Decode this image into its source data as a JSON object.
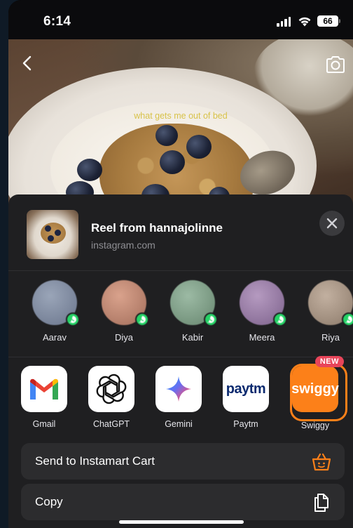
{
  "status_bar": {
    "time": "6:14",
    "battery": "66"
  },
  "reel": {
    "caption": "what gets me out of bed"
  },
  "share": {
    "title": "Reel from hannajolinne",
    "subtitle": "instagram.com"
  },
  "contacts": [
    {
      "name": "Aarav",
      "color": "#7f8aa0"
    },
    {
      "name": "Diya",
      "color": "#c08a76"
    },
    {
      "name": "Kabir",
      "color": "#7fa08a"
    },
    {
      "name": "Meera",
      "color": "#9a7fa6"
    },
    {
      "name": "Riya",
      "color": "#a89686"
    }
  ],
  "apps": [
    {
      "name": "Gmail",
      "icon": "gmail-icon"
    },
    {
      "name": "ChatGPT",
      "icon": "chatgpt-icon"
    },
    {
      "name": "Gemini",
      "icon": "gemini-icon"
    },
    {
      "name": "Paytm",
      "icon": "paytm-icon",
      "logo": "paytm"
    },
    {
      "name": "Swiggy",
      "icon": "swiggy-icon",
      "logo": "swiggy",
      "badge": "NEW"
    }
  ],
  "actions": [
    {
      "label": "Send to Instamart Cart",
      "icon": "basket-icon"
    },
    {
      "label": "Copy",
      "icon": "copy-icon"
    }
  ],
  "colors": {
    "sheet": "#1f1f21",
    "accent_swiggy": "#fc8019",
    "whatsapp": "#25d366",
    "new_badge": "#e8455a"
  }
}
